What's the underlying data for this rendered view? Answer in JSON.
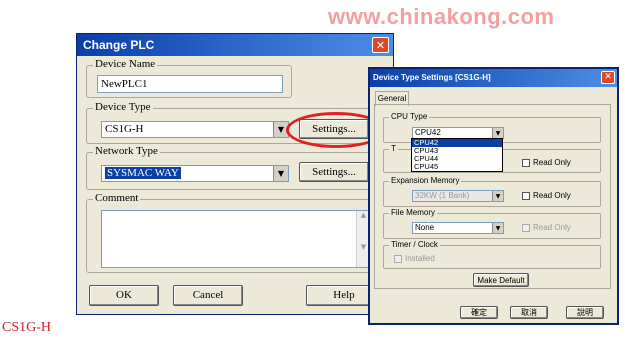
{
  "watermark": "www.chinakong.com",
  "caption": "CS1G-H",
  "change_plc": {
    "title": "Change PLC",
    "device_name": {
      "label": "Device Name",
      "value": "NewPLC1"
    },
    "device_type": {
      "label": "Device Type",
      "value": "CS1G-H",
      "settings_label": "Settings..."
    },
    "network_type": {
      "label": "Network Type",
      "value": "SYSMAC WAY",
      "settings_label": "Settings..."
    },
    "comment": {
      "label": "Comment",
      "value": ""
    },
    "buttons": {
      "ok": "OK",
      "cancel": "Cancel",
      "help": "Help"
    }
  },
  "device_type_settings": {
    "title": "Device Type Settings [CS1G-H]",
    "tab": "General",
    "cpu_type": {
      "label": "CPU Type",
      "value": "CPU42",
      "options": [
        "CPU42",
        "CPU43",
        "CPU44",
        "CPU45"
      ],
      "highlighted": "CPU42"
    },
    "program_memory": {
      "label_fragment": "T",
      "read_only_label": "Read Only"
    },
    "expansion_memory": {
      "label": "Expansion Memory",
      "value": "32KW (1 Bank)",
      "read_only_label": "Read Only"
    },
    "file_memory": {
      "label": "File Memory",
      "value": "None",
      "read_only_label": "Read Only"
    },
    "timer_clock": {
      "label": "Timer / Clock",
      "installed_label": "Installed"
    },
    "make_default_label": "Make Default",
    "buttons": {
      "ok": "確定",
      "cancel": "取消",
      "help": "說明"
    }
  },
  "colors": {
    "title_bar": "#0a3fa8",
    "dialog_bg": "#ece9d8",
    "annotation_red": "#e02020",
    "selection": "#0a3fa8"
  }
}
